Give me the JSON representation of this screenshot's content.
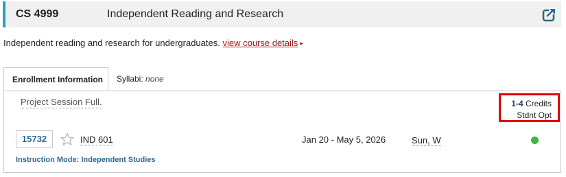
{
  "header": {
    "course_number": "CS 4999",
    "course_title": "Independent Reading and Research",
    "export_icon": "export-icon"
  },
  "description": {
    "text": "Independent reading and research for undergraduates.",
    "link_label": "view course details",
    "link_caret": "▸"
  },
  "tabs": {
    "enrollment_label": "Enrollment Information",
    "syllabi_label": "Syllabi:",
    "syllabi_value": "none"
  },
  "enrollment": {
    "session_note": "Project Session Full.",
    "credits_value": "1-4",
    "credits_label": "Credits",
    "grading_option": "Stdnt Opt"
  },
  "section": {
    "class_number": "15732",
    "star_icon": "star-outline-icon",
    "location": "IND 601",
    "dates": "Jan 20 - May 5, 2026",
    "days": "Sun, W",
    "status_color": "#3cb83c",
    "instruction_mode_label": "Instruction Mode:",
    "instruction_mode_value": "Independent Studies"
  },
  "colors": {
    "accent": "#2aa3ad",
    "link": "#a4161a",
    "highlight_box": "#e0000a",
    "section_text": "#2b6a8e"
  }
}
